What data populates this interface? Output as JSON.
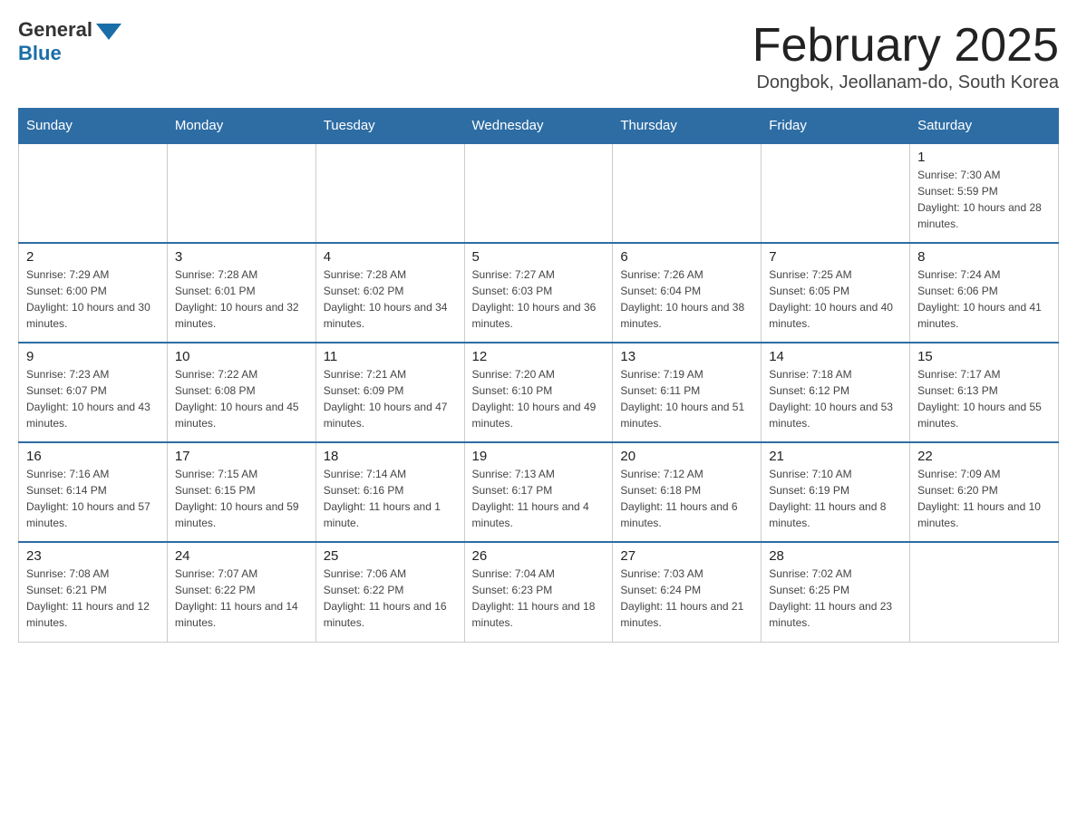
{
  "header": {
    "logo_general": "General",
    "logo_blue": "Blue",
    "month_title": "February 2025",
    "location": "Dongbok, Jeollanam-do, South Korea"
  },
  "days_of_week": [
    "Sunday",
    "Monday",
    "Tuesday",
    "Wednesday",
    "Thursday",
    "Friday",
    "Saturday"
  ],
  "weeks": [
    [
      null,
      null,
      null,
      null,
      null,
      null,
      {
        "day": "1",
        "sunrise": "Sunrise: 7:30 AM",
        "sunset": "Sunset: 5:59 PM",
        "daylight": "Daylight: 10 hours and 28 minutes."
      }
    ],
    [
      {
        "day": "2",
        "sunrise": "Sunrise: 7:29 AM",
        "sunset": "Sunset: 6:00 PM",
        "daylight": "Daylight: 10 hours and 30 minutes."
      },
      {
        "day": "3",
        "sunrise": "Sunrise: 7:28 AM",
        "sunset": "Sunset: 6:01 PM",
        "daylight": "Daylight: 10 hours and 32 minutes."
      },
      {
        "day": "4",
        "sunrise": "Sunrise: 7:28 AM",
        "sunset": "Sunset: 6:02 PM",
        "daylight": "Daylight: 10 hours and 34 minutes."
      },
      {
        "day": "5",
        "sunrise": "Sunrise: 7:27 AM",
        "sunset": "Sunset: 6:03 PM",
        "daylight": "Daylight: 10 hours and 36 minutes."
      },
      {
        "day": "6",
        "sunrise": "Sunrise: 7:26 AM",
        "sunset": "Sunset: 6:04 PM",
        "daylight": "Daylight: 10 hours and 38 minutes."
      },
      {
        "day": "7",
        "sunrise": "Sunrise: 7:25 AM",
        "sunset": "Sunset: 6:05 PM",
        "daylight": "Daylight: 10 hours and 40 minutes."
      },
      {
        "day": "8",
        "sunrise": "Sunrise: 7:24 AM",
        "sunset": "Sunset: 6:06 PM",
        "daylight": "Daylight: 10 hours and 41 minutes."
      }
    ],
    [
      {
        "day": "9",
        "sunrise": "Sunrise: 7:23 AM",
        "sunset": "Sunset: 6:07 PM",
        "daylight": "Daylight: 10 hours and 43 minutes."
      },
      {
        "day": "10",
        "sunrise": "Sunrise: 7:22 AM",
        "sunset": "Sunset: 6:08 PM",
        "daylight": "Daylight: 10 hours and 45 minutes."
      },
      {
        "day": "11",
        "sunrise": "Sunrise: 7:21 AM",
        "sunset": "Sunset: 6:09 PM",
        "daylight": "Daylight: 10 hours and 47 minutes."
      },
      {
        "day": "12",
        "sunrise": "Sunrise: 7:20 AM",
        "sunset": "Sunset: 6:10 PM",
        "daylight": "Daylight: 10 hours and 49 minutes."
      },
      {
        "day": "13",
        "sunrise": "Sunrise: 7:19 AM",
        "sunset": "Sunset: 6:11 PM",
        "daylight": "Daylight: 10 hours and 51 minutes."
      },
      {
        "day": "14",
        "sunrise": "Sunrise: 7:18 AM",
        "sunset": "Sunset: 6:12 PM",
        "daylight": "Daylight: 10 hours and 53 minutes."
      },
      {
        "day": "15",
        "sunrise": "Sunrise: 7:17 AM",
        "sunset": "Sunset: 6:13 PM",
        "daylight": "Daylight: 10 hours and 55 minutes."
      }
    ],
    [
      {
        "day": "16",
        "sunrise": "Sunrise: 7:16 AM",
        "sunset": "Sunset: 6:14 PM",
        "daylight": "Daylight: 10 hours and 57 minutes."
      },
      {
        "day": "17",
        "sunrise": "Sunrise: 7:15 AM",
        "sunset": "Sunset: 6:15 PM",
        "daylight": "Daylight: 10 hours and 59 minutes."
      },
      {
        "day": "18",
        "sunrise": "Sunrise: 7:14 AM",
        "sunset": "Sunset: 6:16 PM",
        "daylight": "Daylight: 11 hours and 1 minute."
      },
      {
        "day": "19",
        "sunrise": "Sunrise: 7:13 AM",
        "sunset": "Sunset: 6:17 PM",
        "daylight": "Daylight: 11 hours and 4 minutes."
      },
      {
        "day": "20",
        "sunrise": "Sunrise: 7:12 AM",
        "sunset": "Sunset: 6:18 PM",
        "daylight": "Daylight: 11 hours and 6 minutes."
      },
      {
        "day": "21",
        "sunrise": "Sunrise: 7:10 AM",
        "sunset": "Sunset: 6:19 PM",
        "daylight": "Daylight: 11 hours and 8 minutes."
      },
      {
        "day": "22",
        "sunrise": "Sunrise: 7:09 AM",
        "sunset": "Sunset: 6:20 PM",
        "daylight": "Daylight: 11 hours and 10 minutes."
      }
    ],
    [
      {
        "day": "23",
        "sunrise": "Sunrise: 7:08 AM",
        "sunset": "Sunset: 6:21 PM",
        "daylight": "Daylight: 11 hours and 12 minutes."
      },
      {
        "day": "24",
        "sunrise": "Sunrise: 7:07 AM",
        "sunset": "Sunset: 6:22 PM",
        "daylight": "Daylight: 11 hours and 14 minutes."
      },
      {
        "day": "25",
        "sunrise": "Sunrise: 7:06 AM",
        "sunset": "Sunset: 6:22 PM",
        "daylight": "Daylight: 11 hours and 16 minutes."
      },
      {
        "day": "26",
        "sunrise": "Sunrise: 7:04 AM",
        "sunset": "Sunset: 6:23 PM",
        "daylight": "Daylight: 11 hours and 18 minutes."
      },
      {
        "day": "27",
        "sunrise": "Sunrise: 7:03 AM",
        "sunset": "Sunset: 6:24 PM",
        "daylight": "Daylight: 11 hours and 21 minutes."
      },
      {
        "day": "28",
        "sunrise": "Sunrise: 7:02 AM",
        "sunset": "Sunset: 6:25 PM",
        "daylight": "Daylight: 11 hours and 23 minutes."
      },
      null
    ]
  ]
}
